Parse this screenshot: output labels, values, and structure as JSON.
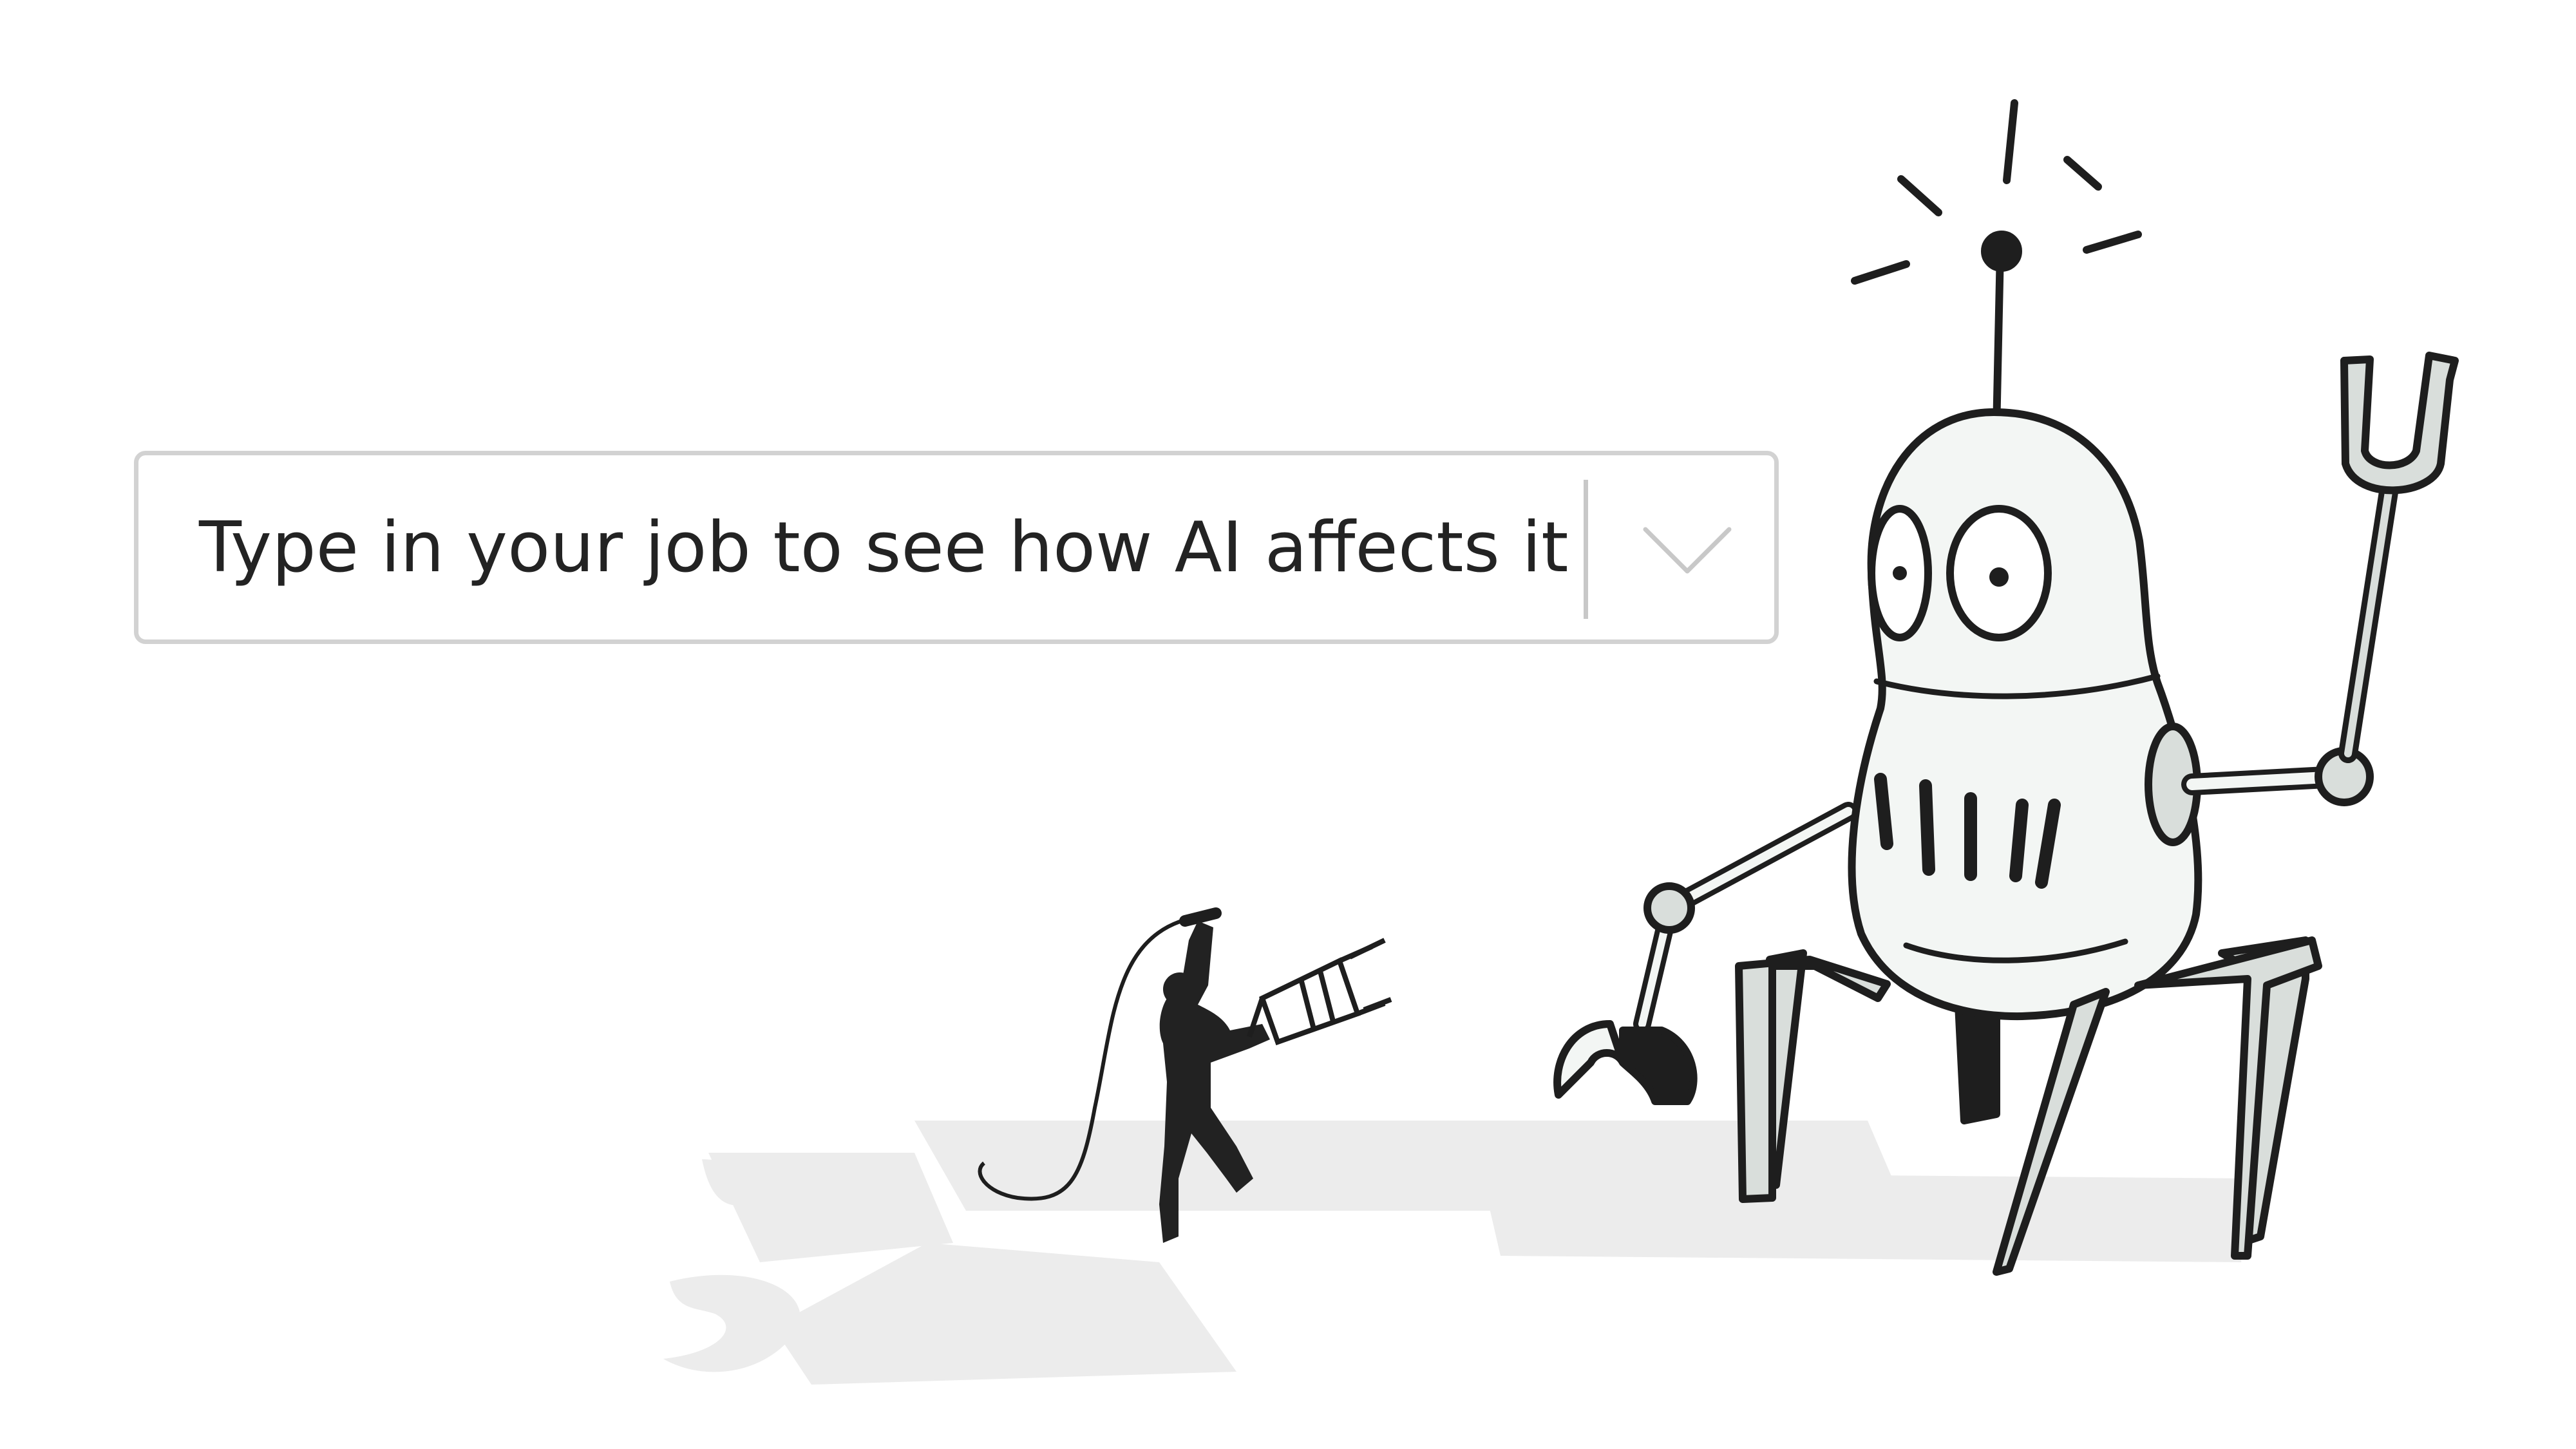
{
  "job_search": {
    "placeholder": "Type in your job to see how AI affects it",
    "dropdown_icon": "chevron-down-icon"
  },
  "illustration": {
    "subject": "small human with whip and chair facing a giant robot",
    "colors": {
      "ink": "#1e1e1e",
      "robot_fill": "#f3f6f4",
      "robot_shade": "#d9dedb",
      "shadow": "#ececec"
    }
  }
}
